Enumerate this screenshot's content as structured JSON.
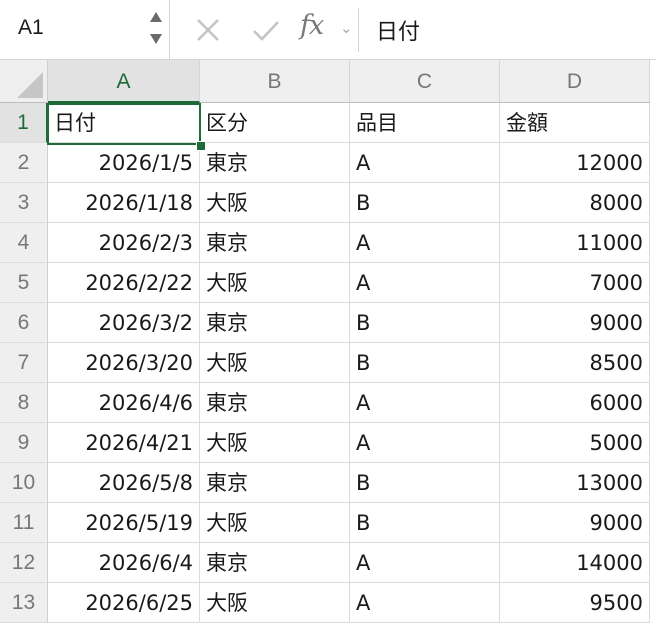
{
  "formula_bar": {
    "name_box": "A1",
    "fx_label": "fx",
    "chevron": "⌄",
    "content": "日付"
  },
  "sheet": {
    "columns": [
      {
        "label": "A",
        "selected": true
      },
      {
        "label": "B",
        "selected": false
      },
      {
        "label": "C",
        "selected": false
      },
      {
        "label": "D",
        "selected": false
      }
    ],
    "row_numbers": [
      "1",
      "2",
      "3",
      "4",
      "5",
      "6",
      "7",
      "8",
      "9",
      "10",
      "11",
      "12",
      "13"
    ],
    "selected_row": "1",
    "active_cell": "A1",
    "rows": [
      [
        "日付",
        "区分",
        "品目",
        "金額"
      ],
      [
        "2026/1/5",
        "東京",
        "A",
        "12000"
      ],
      [
        "2026/1/18",
        "大阪",
        "B",
        "8000"
      ],
      [
        "2026/2/3",
        "東京",
        "A",
        "11000"
      ],
      [
        "2026/2/22",
        "大阪",
        "A",
        "7000"
      ],
      [
        "2026/3/2",
        "東京",
        "B",
        "9000"
      ],
      [
        "2026/3/20",
        "大阪",
        "B",
        "8500"
      ],
      [
        "2026/4/6",
        "東京",
        "A",
        "6000"
      ],
      [
        "2026/4/21",
        "大阪",
        "A",
        "5000"
      ],
      [
        "2026/5/8",
        "東京",
        "B",
        "13000"
      ],
      [
        "2026/5/19",
        "大阪",
        "B",
        "9000"
      ],
      [
        "2026/6/4",
        "東京",
        "A",
        "14000"
      ],
      [
        "2026/6/25",
        "大阪",
        "A",
        "9500"
      ]
    ]
  },
  "colors": {
    "accent": "#1d6b36",
    "header_bg": "#efefef",
    "gridline": "#dcdcdc"
  },
  "icons": {
    "cancel": "close-icon",
    "confirm": "checkmark-icon",
    "function": "fx-icon",
    "stepper": "stepper-arrows-icon"
  }
}
